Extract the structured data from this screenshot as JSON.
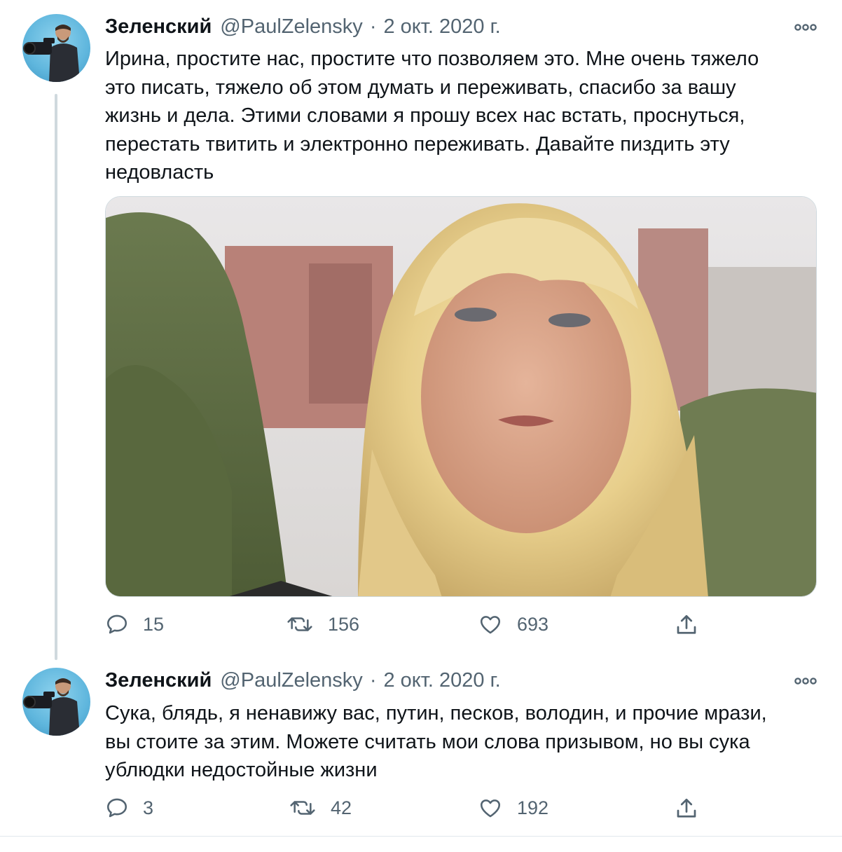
{
  "tweets": [
    {
      "author_name": "Зеленский",
      "handle": "@PaulZelensky",
      "separator": "·",
      "date": "2 окт. 2020 г.",
      "text": "Ирина, простите нас, простите что позволяем это. Мне очень тяжело\nэто писать, тяжело об этом думать и переживать, спасибо за вашу\nжизнь и дела. Этими словами я прошу всех нас встать, проснуться,\nперестать твитить и электронно переживать. Давайте пиздить эту\nнедовласть",
      "replies": "15",
      "retweets": "156",
      "likes": "693",
      "has_photo": true,
      "reply_icon": "reply-icon",
      "retweet_icon": "retweet-icon",
      "like_icon": "heart-icon",
      "share_icon": "share-icon"
    },
    {
      "author_name": "Зеленский",
      "handle": "@PaulZelensky",
      "separator": "·",
      "date": "2 окт. 2020 г.",
      "text": "Сука, блядь, я ненавижу вас, путин, песков, володин, и прочие мрази,\nвы стоите за этим. Можете считать мои слова призывом, но вы сука\nублюдки недостойные жизни",
      "replies": "3",
      "retweets": "42",
      "likes": "192",
      "has_photo": false,
      "reply_icon": "reply-icon",
      "retweet_icon": "retweet-icon",
      "like_icon": "heart-icon",
      "share_icon": "share-icon"
    }
  ],
  "colors": {
    "text_primary": "#0f1419",
    "text_secondary": "#536471",
    "thread_line": "#cfd9de",
    "avatar_bg": "#5fb6dd"
  }
}
